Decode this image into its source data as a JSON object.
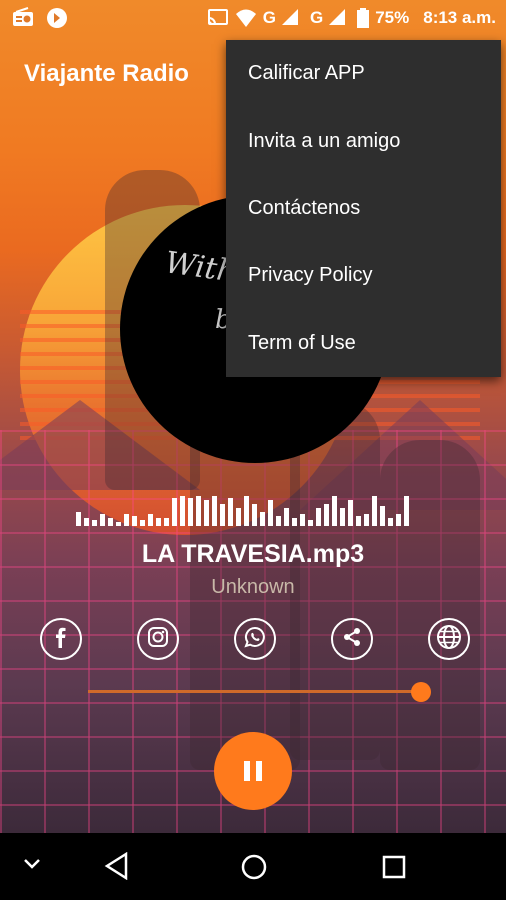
{
  "status_bar": {
    "network_1": "G",
    "network_2": "G",
    "battery": "75%",
    "time": "8:13 a.m."
  },
  "app": {
    "title": "Viajante Radio"
  },
  "album_art": {
    "text_line1": "With",
    "text_line2": "b"
  },
  "overflow_menu": {
    "items": [
      {
        "label": "Calificar APP"
      },
      {
        "label": "Invita a un amigo"
      },
      {
        "label": "Contáctenos"
      },
      {
        "label": "Privacy Policy"
      },
      {
        "label": "Term of Use"
      }
    ]
  },
  "player": {
    "song": "LA TRAVESIA.mp3",
    "artist": "Unknown",
    "volume_level": 0.96,
    "state": "playing"
  },
  "social_links": [
    "facebook-icon",
    "instagram-icon",
    "whatsapp-icon",
    "share-icon",
    "globe-icon"
  ],
  "colors": {
    "accent": "#ff7a1c",
    "menu_bg": "#2e2e2e",
    "title": "#ffffff"
  }
}
